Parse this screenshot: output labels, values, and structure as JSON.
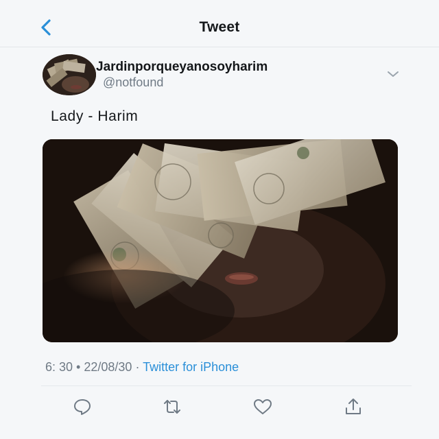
{
  "header": {
    "title": "Tweet",
    "back_icon": "chevron-left-icon",
    "accent_color": "#2a8fd8"
  },
  "author": {
    "display_name": "Jardinporqueyanosoyharim",
    "username": "@notfound",
    "avatar": "avatar-photo",
    "menu_icon": "chevron-down-icon"
  },
  "tweet": {
    "text": "Lady - Harim",
    "media": "photo-of-face-covered-by-dollar-bills"
  },
  "meta": {
    "time": "6: 30",
    "separator1": " • ",
    "date": "22/08/30",
    "separator2": " · ",
    "source": "Twitter for iPhone"
  },
  "actions": {
    "reply_icon": "reply-icon",
    "retweet_icon": "retweet-icon",
    "like_icon": "heart-icon",
    "share_icon": "share-icon"
  }
}
